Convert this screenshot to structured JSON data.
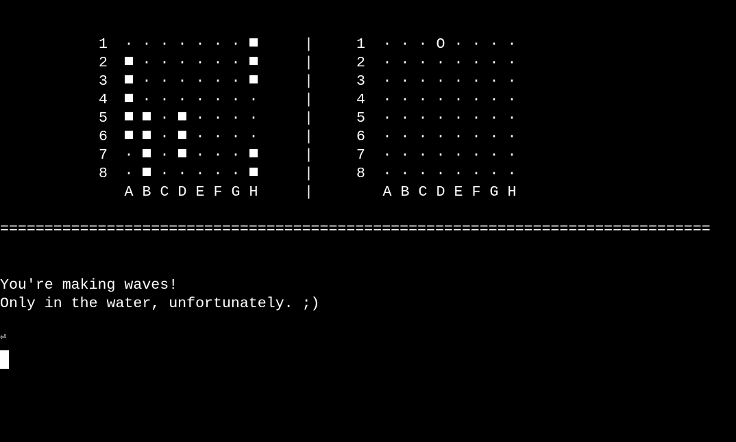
{
  "player_board": {
    "rows": [
      {
        "label": "1",
        "cells": [
          ".",
          ".",
          ".",
          ".",
          ".",
          ".",
          ".",
          "#"
        ]
      },
      {
        "label": "2",
        "cells": [
          "#",
          ".",
          ".",
          ".",
          ".",
          ".",
          ".",
          "#"
        ]
      },
      {
        "label": "3",
        "cells": [
          "#",
          ".",
          ".",
          ".",
          ".",
          ".",
          ".",
          "#"
        ]
      },
      {
        "label": "4",
        "cells": [
          "#",
          ".",
          ".",
          ".",
          ".",
          ".",
          ".",
          "."
        ]
      },
      {
        "label": "5",
        "cells": [
          "#",
          "#",
          ".",
          "#",
          ".",
          ".",
          ".",
          "."
        ]
      },
      {
        "label": "6",
        "cells": [
          "#",
          "#",
          ".",
          "#",
          ".",
          ".",
          ".",
          "."
        ]
      },
      {
        "label": "7",
        "cells": [
          ".",
          "#",
          ".",
          "#",
          ".",
          ".",
          ".",
          "#"
        ]
      },
      {
        "label": "8",
        "cells": [
          ".",
          "#",
          ".",
          ".",
          ".",
          ".",
          ".",
          "#"
        ]
      }
    ],
    "columns": [
      "A",
      "B",
      "C",
      "D",
      "E",
      "F",
      "G",
      "H"
    ]
  },
  "separator": "|",
  "opponent_board": {
    "rows": [
      {
        "label": "1",
        "cells": [
          ".",
          ".",
          ".",
          "O",
          ".",
          ".",
          ".",
          "."
        ]
      },
      {
        "label": "2",
        "cells": [
          ".",
          ".",
          ".",
          ".",
          ".",
          ".",
          ".",
          "."
        ]
      },
      {
        "label": "3",
        "cells": [
          ".",
          ".",
          ".",
          ".",
          ".",
          ".",
          ".",
          "."
        ]
      },
      {
        "label": "4",
        "cells": [
          ".",
          ".",
          ".",
          ".",
          ".",
          ".",
          ".",
          "."
        ]
      },
      {
        "label": "5",
        "cells": [
          ".",
          ".",
          ".",
          ".",
          ".",
          ".",
          ".",
          "."
        ]
      },
      {
        "label": "6",
        "cells": [
          ".",
          ".",
          ".",
          ".",
          ".",
          ".",
          ".",
          "."
        ]
      },
      {
        "label": "7",
        "cells": [
          ".",
          ".",
          ".",
          ".",
          ".",
          ".",
          ".",
          "."
        ]
      },
      {
        "label": "8",
        "cells": [
          ".",
          ".",
          ".",
          ".",
          ".",
          ".",
          ".",
          "."
        ]
      }
    ],
    "columns": [
      "A",
      "B",
      "C",
      "D",
      "E",
      "F",
      "G",
      "H"
    ]
  },
  "divider": "================================================================================",
  "messages": {
    "line1": "You're making waves!",
    "line2": "Only in the water, unfortunately. ;)"
  },
  "prompt": {
    "enter_symbol": "⏎"
  },
  "icons": {
    "ship": "filled-square",
    "miss": "letter-o",
    "water": "middle-dot",
    "enter": "return-arrow-icon",
    "cursor": "block-cursor"
  },
  "colors": {
    "background": "#000000",
    "foreground": "#ffffff"
  }
}
